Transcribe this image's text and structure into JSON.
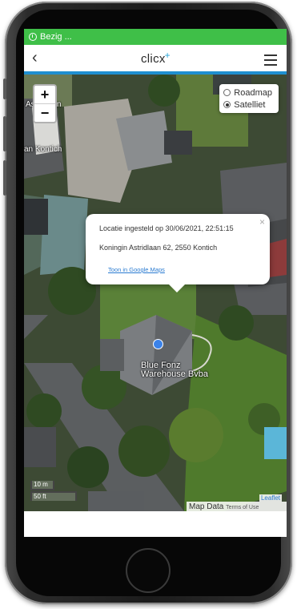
{
  "status": {
    "text": "Bezig ..."
  },
  "header": {
    "back_icon": "‹",
    "logo_text": "clicx",
    "logo_plus": "+"
  },
  "map": {
    "zoom_in": "+",
    "zoom_out": "−",
    "layers": {
      "roadmap": "Roadmap",
      "satellite": "Satelliet",
      "selected": "Satelliet"
    },
    "labels": {
      "top": "Astridlaan",
      "left": "an Kontich"
    },
    "scale": {
      "meters": "10 m",
      "feet": "50 ft"
    },
    "leaflet": "Leaflet",
    "map_data": "Map Data",
    "terms": "Terms of Use",
    "place": {
      "line1": "Blue Fonz",
      "line2": "Warehouse Bvba"
    }
  },
  "popup": {
    "close": "×",
    "location": "Locatie ingesteld op 30/06/2021, 22:51:15",
    "address": "Koningin Astridlaan 62, 2550 Kontich",
    "link": "Toon in Google Maps"
  },
  "colors": {
    "status_bar": "#3fbf48",
    "accent": "#1f8fd0",
    "link": "#2a7bd1"
  }
}
